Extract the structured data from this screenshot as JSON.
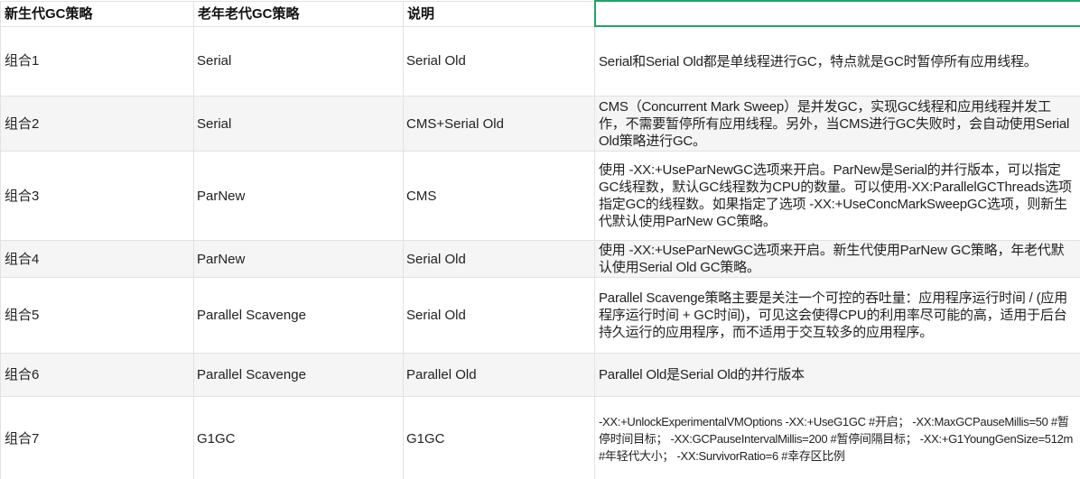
{
  "header": {
    "col1": "新生代GC策略",
    "col2": "老年老代GC策略",
    "col3": "说明",
    "col4": ""
  },
  "rows": [
    {
      "combo": "组合1",
      "young": "Serial",
      "old": "Serial Old",
      "desc": "Serial和Serial Old都是单线程进行GC，特点就是GC时暂停所有应用线程。"
    },
    {
      "combo": "组合2",
      "young": "Serial",
      "old": "CMS+Serial Old",
      "desc": "CMS（Concurrent Mark Sweep）是并发GC，实现GC线程和应用线程并发工作，不需要暂停所有应用线程。另外，当CMS进行GC失败时，会自动使用Serial Old策略进行GC。"
    },
    {
      "combo": "组合3",
      "young": "ParNew",
      "old": "CMS",
      "desc": "使用 -XX:+UseParNewGC选项来开启。ParNew是Serial的并行版本，可以指定GC线程数，默认GC线程数为CPU的数量。可以使用-XX:ParallelGCThreads选项指定GC的线程数。如果指定了选项 -XX:+UseConcMarkSweepGC选项，则新生代默认使用ParNew GC策略。"
    },
    {
      "combo": "组合4",
      "young": "ParNew",
      "old": "Serial Old",
      "desc": "使用 -XX:+UseParNewGC选项来开启。新生代使用ParNew GC策略，年老代默认使用Serial Old GC策略。"
    },
    {
      "combo": "组合5",
      "young": "Parallel Scavenge",
      "old": "Serial Old",
      "desc": "Parallel Scavenge策略主要是关注一个可控的吞吐量：应用程序运行时间 / (应用程序运行时间 + GC时间)，可见这会使得CPU的利用率尽可能的高，适用于后台持久运行的应用程序，而不适用于交互较多的应用程序。"
    },
    {
      "combo": "组合6",
      "young": "Parallel Scavenge",
      "old": "Parallel Old",
      "desc": "Parallel Old是Serial Old的并行版本"
    },
    {
      "combo": "组合7",
      "young": "G1GC",
      "old": "G1GC",
      "desc": "-XX:+UnlockExperimentalVMOptions -XX:+UseG1GC #开启； -XX:MaxGCPauseMillis=50 #暂停时间目标； -XX:GCPauseIntervalMillis=200 #暂停间隔目标； -XX:+G1YoungGenSize=512m #年轻代大小； -XX:SurvivorRatio=6 #幸存区比例"
    }
  ],
  "colors": {
    "selection_border": "#21a366",
    "grid_line": "#e2e2e2",
    "alt_row": "#f5f5f5"
  }
}
